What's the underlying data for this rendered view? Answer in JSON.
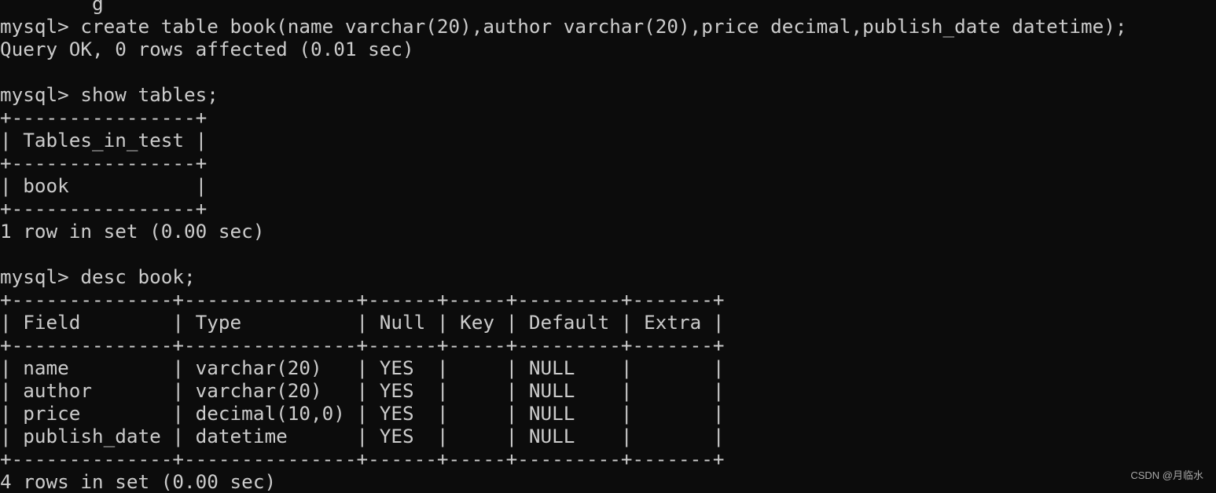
{
  "terminal": {
    "lines": [
      "        g",
      "mysql> create table book(name varchar(20),author varchar(20),price decimal,publish_date datetime);",
      "Query OK, 0 rows affected (0.01 sec)",
      "",
      "mysql> show tables;",
      "+----------------+",
      "| Tables_in_test |",
      "+----------------+",
      "| book           |",
      "+----------------+",
      "1 row in set (0.00 sec)",
      "",
      "mysql> desc book;",
      "+--------------+---------------+------+-----+---------+-------+",
      "| Field        | Type          | Null | Key | Default | Extra |",
      "+--------------+---------------+------+-----+---------+-------+",
      "| name         | varchar(20)   | YES  |     | NULL    |       |",
      "| author       | varchar(20)   | YES  |     | NULL    |       |",
      "| price        | decimal(10,0) | YES  |     | NULL    |       |",
      "| publish_date | datetime      | YES  |     | NULL    |       |",
      "+--------------+---------------+------+-----+---------+-------+",
      "4 rows in set (0.00 sec)"
    ]
  },
  "watermark": "CSDN @月临水"
}
